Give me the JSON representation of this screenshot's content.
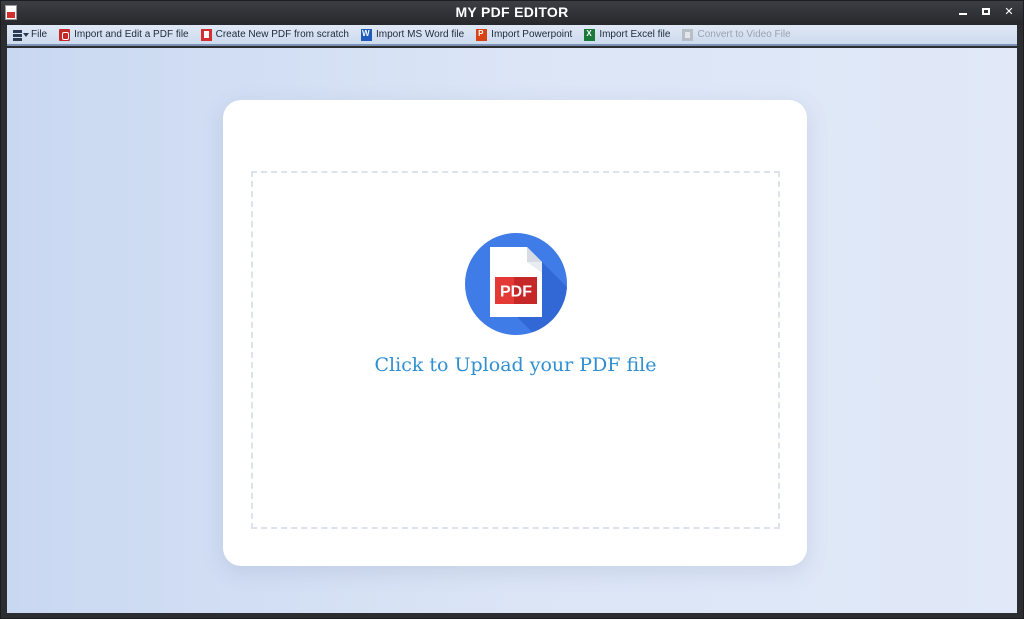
{
  "window": {
    "title": "MY PDF EDITOR"
  },
  "menu": {
    "items": [
      {
        "label": "File",
        "icon": "menu-list-icon",
        "enabled": true
      },
      {
        "label": "Import and Edit a PDF file",
        "icon": "acrobat-pdf-icon",
        "enabled": true
      },
      {
        "label": "Create New PDF from scratch",
        "icon": "new-pdf-icon",
        "enabled": true
      },
      {
        "label": "Import MS Word file",
        "icon": "word-icon",
        "enabled": true
      },
      {
        "label": "Import Powerpoint",
        "icon": "powerpoint-icon",
        "enabled": true
      },
      {
        "label": "Import Excel file",
        "icon": "excel-icon",
        "enabled": true
      },
      {
        "label": "Convert to Video File",
        "icon": "video-file-icon",
        "enabled": false
      }
    ]
  },
  "upload": {
    "icon_text": "PDF",
    "label": "Click to Upload your PDF file"
  },
  "colors": {
    "accent": "#2f8fd0",
    "pdf_red": "#e53935",
    "circle_blue": "#3f7ce8"
  }
}
